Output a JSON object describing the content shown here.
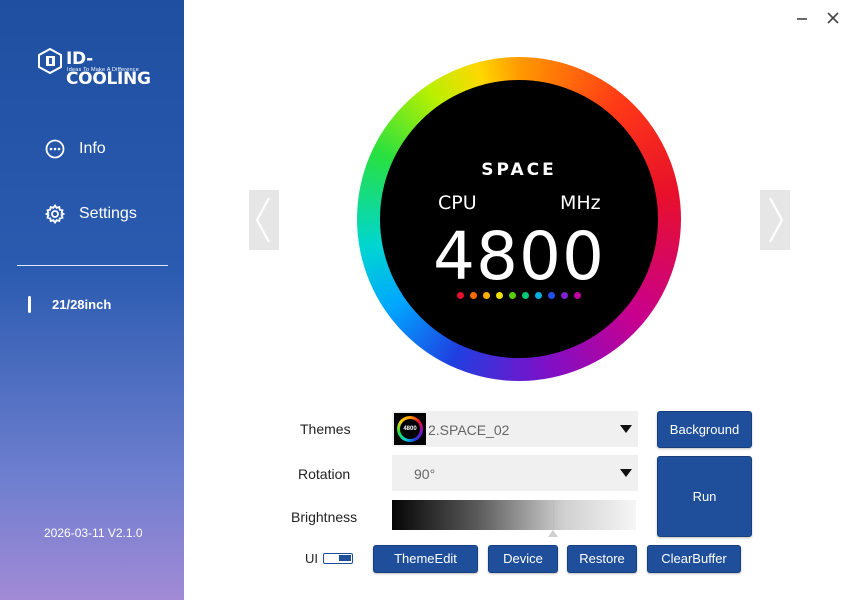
{
  "brand": {
    "name": "ID-COOLING",
    "tagline": "Ideas To Make A Difference"
  },
  "sidebar": {
    "items": [
      {
        "label": "Info",
        "icon": "dots-circle-icon"
      },
      {
        "label": "Settings",
        "icon": "gear-icon"
      }
    ],
    "device": "21/28inch",
    "version": "2026-03-11 V2.1.0"
  },
  "window": {
    "minimize": "—",
    "close": "✕"
  },
  "preview": {
    "theme_name": "SPACE",
    "metric": "CPU",
    "unit": "MHz",
    "value": "4800",
    "thumb_value": "4800",
    "dot_colors": [
      "#e8102a",
      "#ff6a00",
      "#ffb000",
      "#f0e000",
      "#58d000",
      "#00c878",
      "#00b0e0",
      "#2050f0",
      "#8020d0",
      "#c000a0"
    ]
  },
  "controls": {
    "themes_label": "Themes",
    "themes_value": "2.SPACE_02",
    "rotation_label": "Rotation",
    "rotation_value": "90°",
    "brightness_label": "Brightness",
    "brightness_level": 0.66,
    "ui_label": "UI",
    "ui_toggle_on": true
  },
  "buttons": {
    "background": "Background",
    "run": "Run",
    "theme_edit": "ThemeEdit",
    "device": "Device",
    "restore": "Restore",
    "clear_buffer": "ClearBuffer"
  },
  "colors": {
    "accent": "#1f4f9b",
    "sidebar_top": "#1f4fa0",
    "sidebar_bottom": "#a28ad6"
  }
}
